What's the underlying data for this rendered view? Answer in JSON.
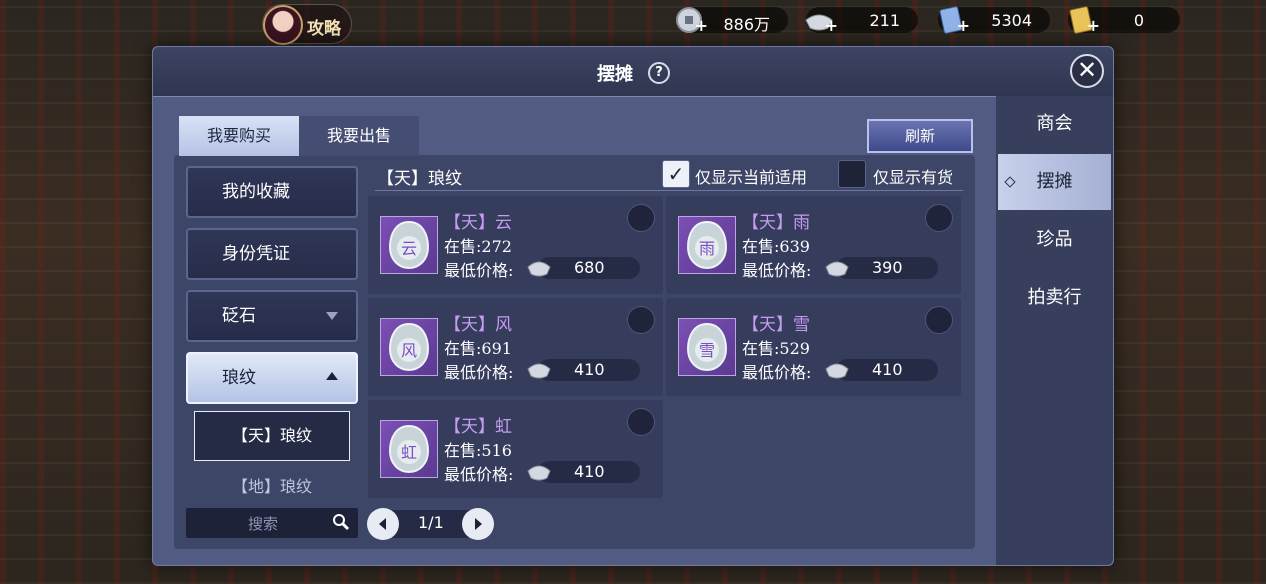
{
  "topbar": {
    "guide_label": "攻略",
    "currencies": [
      {
        "icon": "silver-coin-icon",
        "value": "886万"
      },
      {
        "icon": "silver-ingot-icon",
        "value": "211"
      },
      {
        "icon": "blue-ticket-icon",
        "value": "5304"
      },
      {
        "icon": "gold-ticket-icon",
        "value": "0"
      }
    ]
  },
  "panel": {
    "title": "摆摊",
    "help": "?",
    "close": "✕"
  },
  "right_nav": [
    "商会",
    "摆摊",
    "珍品",
    "拍卖行"
  ],
  "tabs": {
    "buy": "我要购买",
    "sell": "我要出售"
  },
  "refresh_label": "刷新",
  "categories": [
    {
      "label": "我的收藏"
    },
    {
      "label": "身份凭证"
    },
    {
      "label": "砭石"
    },
    {
      "label": "琅纹"
    }
  ],
  "sub_items": [
    "【天】琅纹",
    "【地】琅纹"
  ],
  "search_placeholder": "搜索",
  "list_title": "【天】琅纹",
  "filters": {
    "current_applicable": "仅显示当前适用",
    "in_stock": "仅显示有货"
  },
  "items": [
    {
      "name": "【天】云",
      "stock_label": "在售:",
      "stock": "272",
      "price_label": "最低价格:",
      "price": "680",
      "glyph": "云"
    },
    {
      "name": "【天】雨",
      "stock_label": "在售:",
      "stock": "639",
      "price_label": "最低价格:",
      "price": "390",
      "glyph": "雨"
    },
    {
      "name": "【天】风",
      "stock_label": "在售:",
      "stock": "691",
      "price_label": "最低价格:",
      "price": "410",
      "glyph": "风"
    },
    {
      "name": "【天】雪",
      "stock_label": "在售:",
      "stock": "529",
      "price_label": "最低价格:",
      "price": "410",
      "glyph": "雪"
    },
    {
      "name": "【天】虹",
      "stock_label": "在售:",
      "stock": "516",
      "price_label": "最低价格:",
      "price": "410",
      "glyph": "虹"
    }
  ],
  "pager": "1/1",
  "colors": {
    "panel": "#525c83",
    "item_name": "#c59cf0",
    "accent": "#b5c3e6"
  }
}
